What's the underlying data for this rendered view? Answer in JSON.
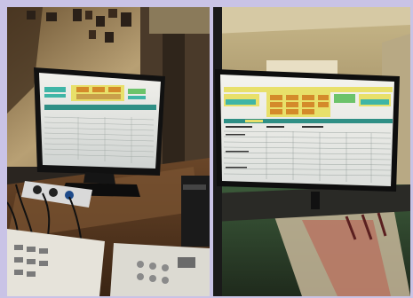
{
  "left_photo": {
    "screen": {
      "header_label": "",
      "rows": 14
    }
  },
  "right_photo": {
    "screen": {
      "rows": 16
    }
  },
  "colors": {
    "background_border": "#c9c3e6",
    "wall": "#b59a6a",
    "desk": "#5a3b22",
    "screen_yellow": "#e8e06a",
    "screen_teal": "#3fb5a6",
    "screen_orange": "#d48a2a"
  }
}
